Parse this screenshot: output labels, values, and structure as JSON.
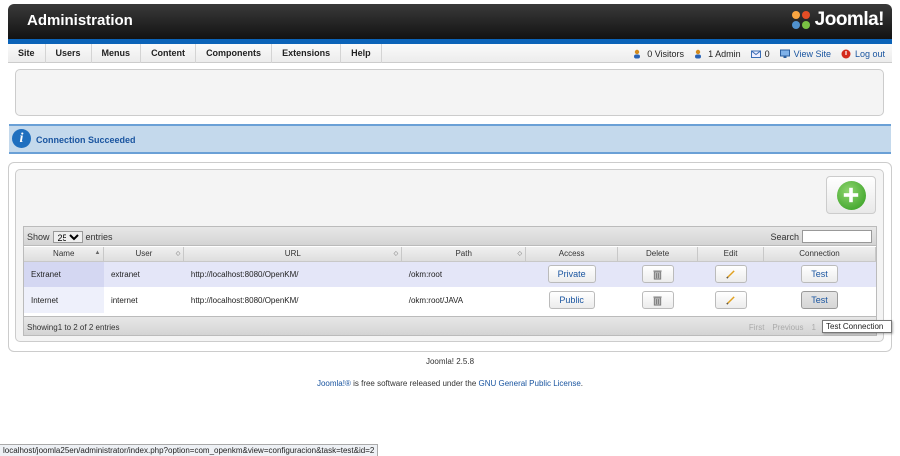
{
  "header": {
    "title": "Administration",
    "logo_text": "Joomla!"
  },
  "menu": [
    "Site",
    "Users",
    "Menus",
    "Content",
    "Components",
    "Extensions",
    "Help"
  ],
  "status": {
    "visitors": "0 Visitors",
    "admins": "1 Admin",
    "messages": "0",
    "view_site": "View Site",
    "logout": "Log out"
  },
  "message": {
    "text": "Connection Succeeded"
  },
  "table": {
    "show_label": "Show",
    "entries_label": "entries",
    "page_size": "25",
    "search_label": "Search",
    "search_value": "",
    "columns": [
      "Name",
      "User",
      "URL",
      "Path",
      "Access",
      "Delete",
      "Edit",
      "Connection"
    ],
    "rows": [
      {
        "name": "Extranet",
        "user": "extranet",
        "url": "http://localhost:8080/OpenKM/",
        "path": "/okm:root",
        "access": "Private",
        "connection": "Test"
      },
      {
        "name": "Internet",
        "user": "internet",
        "url": "http://localhost:8080/OpenKM/",
        "path": "/okm:root/JAVA",
        "access": "Public",
        "connection": "Test"
      }
    ],
    "info": "Showing1 to 2 of 2 entries",
    "pager": {
      "first": "First",
      "previous": "Previous",
      "page": "1"
    },
    "tooltip": "Test Connection"
  },
  "footer": {
    "version": "Joomla! 2.5.8",
    "license_brand": "Joomla!®",
    "license_middle": " is free software released under the ",
    "license_link": "GNU General Public License",
    "license_end": "."
  },
  "statusbar_url": "localhost/joomla25en/administrator/index.php?option=com_openkm&view=configuracion&task=test&id=2",
  "colors": {
    "accent": "#0b63b8",
    "link": "#1a55a0",
    "message_bg": "#c4d9ec",
    "add_green": "#2e9a1c"
  }
}
